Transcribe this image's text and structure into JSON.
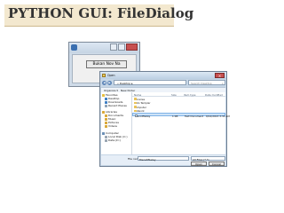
{
  "slide": {
    "title": "PYTHON GUI: FileDialog"
  },
  "tk_window": {
    "button_label": "Bukan Nov Na"
  },
  "dialog": {
    "title": "Open",
    "address": "« Desktop  ▸",
    "search_placeholder": "Search Desktop",
    "toolbar": {
      "organize": "Organize ▾",
      "new_folder": "New folder"
    },
    "nav_items": [
      {
        "label": "Favorites",
        "icon": "star-icon"
      },
      {
        "label": "Desktop",
        "icon": "desktop-icon"
      },
      {
        "label": "Downloads",
        "icon": "downloads-icon"
      },
      {
        "label": "Recent Places",
        "icon": "recent-icon"
      },
      {
        "label": "Libraries",
        "icon": "library-icon"
      },
      {
        "label": "Documents",
        "icon": "documents-icon"
      },
      {
        "label": "Music",
        "icon": "music-icon"
      },
      {
        "label": "Pictures",
        "icon": "pictures-icon"
      },
      {
        "label": "Videos",
        "icon": "videos-icon"
      },
      {
        "label": "Computer",
        "icon": "computer-icon"
      },
      {
        "label": "Local Disk (C:)",
        "icon": "disk-icon"
      },
      {
        "label": "Data (D:)",
        "icon": "disk-icon"
      }
    ],
    "columns": {
      "name": "Name",
      "size": "Size",
      "type": "Item type",
      "date": "Date modified"
    },
    "files": [
      {
        "name": "Libraries",
        "size": "",
        "type": "",
        "date": "",
        "kind": "folder"
      },
      {
        "name": "Anto Templer",
        "size": "",
        "type": "",
        "date": "",
        "kind": "folder"
      },
      {
        "name": "Computer",
        "size": "",
        "type": "",
        "date": "",
        "kind": "folder"
      },
      {
        "name": "Network",
        "size": "",
        "type": "",
        "date": "",
        "kind": "folder"
      },
      {
        "name": "filenotfilelay",
        "size": "1 KB",
        "type": "Text Document",
        "date": "9/12/2013 3:31 AM",
        "kind": "file"
      }
    ],
    "filename_label": "File name:",
    "filename_value": "filenotfilelay",
    "filetype_value": "All Files (*.*)",
    "open_label": "Open",
    "cancel_label": "Cancel"
  },
  "colors": {
    "title_band": "#f3e8cf",
    "selection": "#cde3f8",
    "close": "#c75050"
  }
}
